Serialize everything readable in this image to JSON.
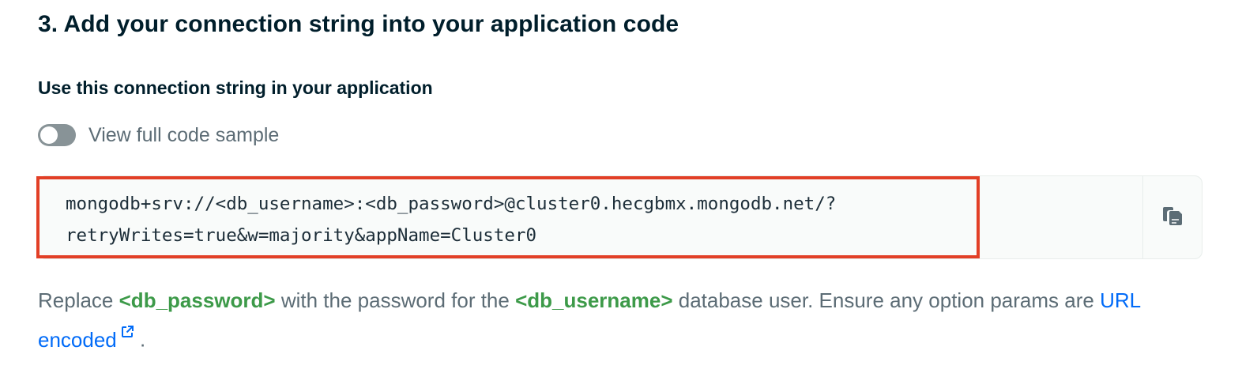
{
  "step": {
    "title": "3. Add your connection string into your application code"
  },
  "section": {
    "subtitle": "Use this connection string in your application"
  },
  "toggle": {
    "label": "View full code sample",
    "checked": false
  },
  "connection": {
    "line1": "mongodb+srv://<db_username>:<db_password>@cluster0.hecgbmx.mongodb.net/?",
    "line2": "retryWrites=true&w=majority&appName=Cluster0",
    "copy_icon": "copy-icon"
  },
  "description": {
    "part1": "Replace ",
    "token_password": "<db_password>",
    "part2": " with the password for the ",
    "token_username": "<db_username>",
    "part3": " database user. Ensure any option params are ",
    "link_text": "URL encoded",
    "link_icon": "external-link-icon",
    "part4": " ."
  },
  "colors": {
    "highlight_border": "#e23f26",
    "code_token": "#3d9a49",
    "link": "#016bf8"
  }
}
